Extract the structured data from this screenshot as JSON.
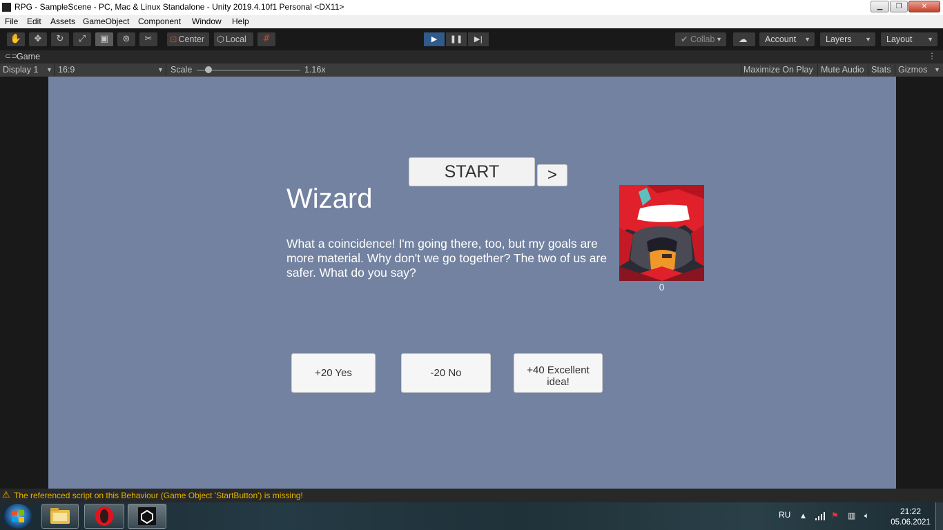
{
  "window": {
    "title": "RPG - SampleScene - PC, Mac & Linux Standalone - Unity 2019.4.10f1 Personal <DX11>",
    "controls": {
      "minimize": "▁",
      "maximize": "❐",
      "close": "✕"
    }
  },
  "menu": [
    "File",
    "Edit",
    "Assets",
    "GameObject",
    "Component",
    "Window",
    "Help"
  ],
  "toolbar": {
    "tools": [
      "hand-icon",
      "move-icon",
      "rotate-icon",
      "scale-icon",
      "rect-icon",
      "transform-icon",
      "custom-tool-icon"
    ],
    "pivot_label": "Center",
    "space_label": "Local",
    "grid_icon": "grid-snap-icon",
    "collab_label": "Collab",
    "account_label": "Account",
    "layers_label": "Layers",
    "layout_label": "Layout",
    "play_icon": "▶",
    "pause_icon": "❚❚",
    "step_icon": "▶|"
  },
  "game_tab": {
    "label": "Game",
    "menu_icon": "⋮"
  },
  "game_toolbar": {
    "display": "Display 1",
    "aspect": "16:9",
    "scale_label": "Scale",
    "scale_value": "1.16x",
    "scale_level": 0.08,
    "maximize_on_play": "Maximize On Play",
    "mute_audio": "Mute Audio",
    "stats": "Stats",
    "gizmos": "Gizmos"
  },
  "game": {
    "start_label": "START",
    "next_label": ">",
    "npc_name": "Wizard",
    "dialog": "What a coincidence! I'm going there, too, but my goals are more material. Why don't we go together? The two of us are safer. What do you say?",
    "score": "0",
    "choices": [
      "+20 Yes",
      "-20 No",
      "+40 Excellent idea!"
    ]
  },
  "status": {
    "message": "The referenced script on this Behaviour (Game Object 'StartButton') is missing!"
  },
  "taskbar": {
    "language": "RU",
    "time": "21:22",
    "date": "05.06.2021",
    "apps": [
      "explorer-icon",
      "opera-icon",
      "unity-icon"
    ]
  },
  "colors": {
    "viewport": "#7282a0",
    "editor_bg": "#191919",
    "play_active": "#2f5a8a",
    "warning": "#e4b400"
  }
}
